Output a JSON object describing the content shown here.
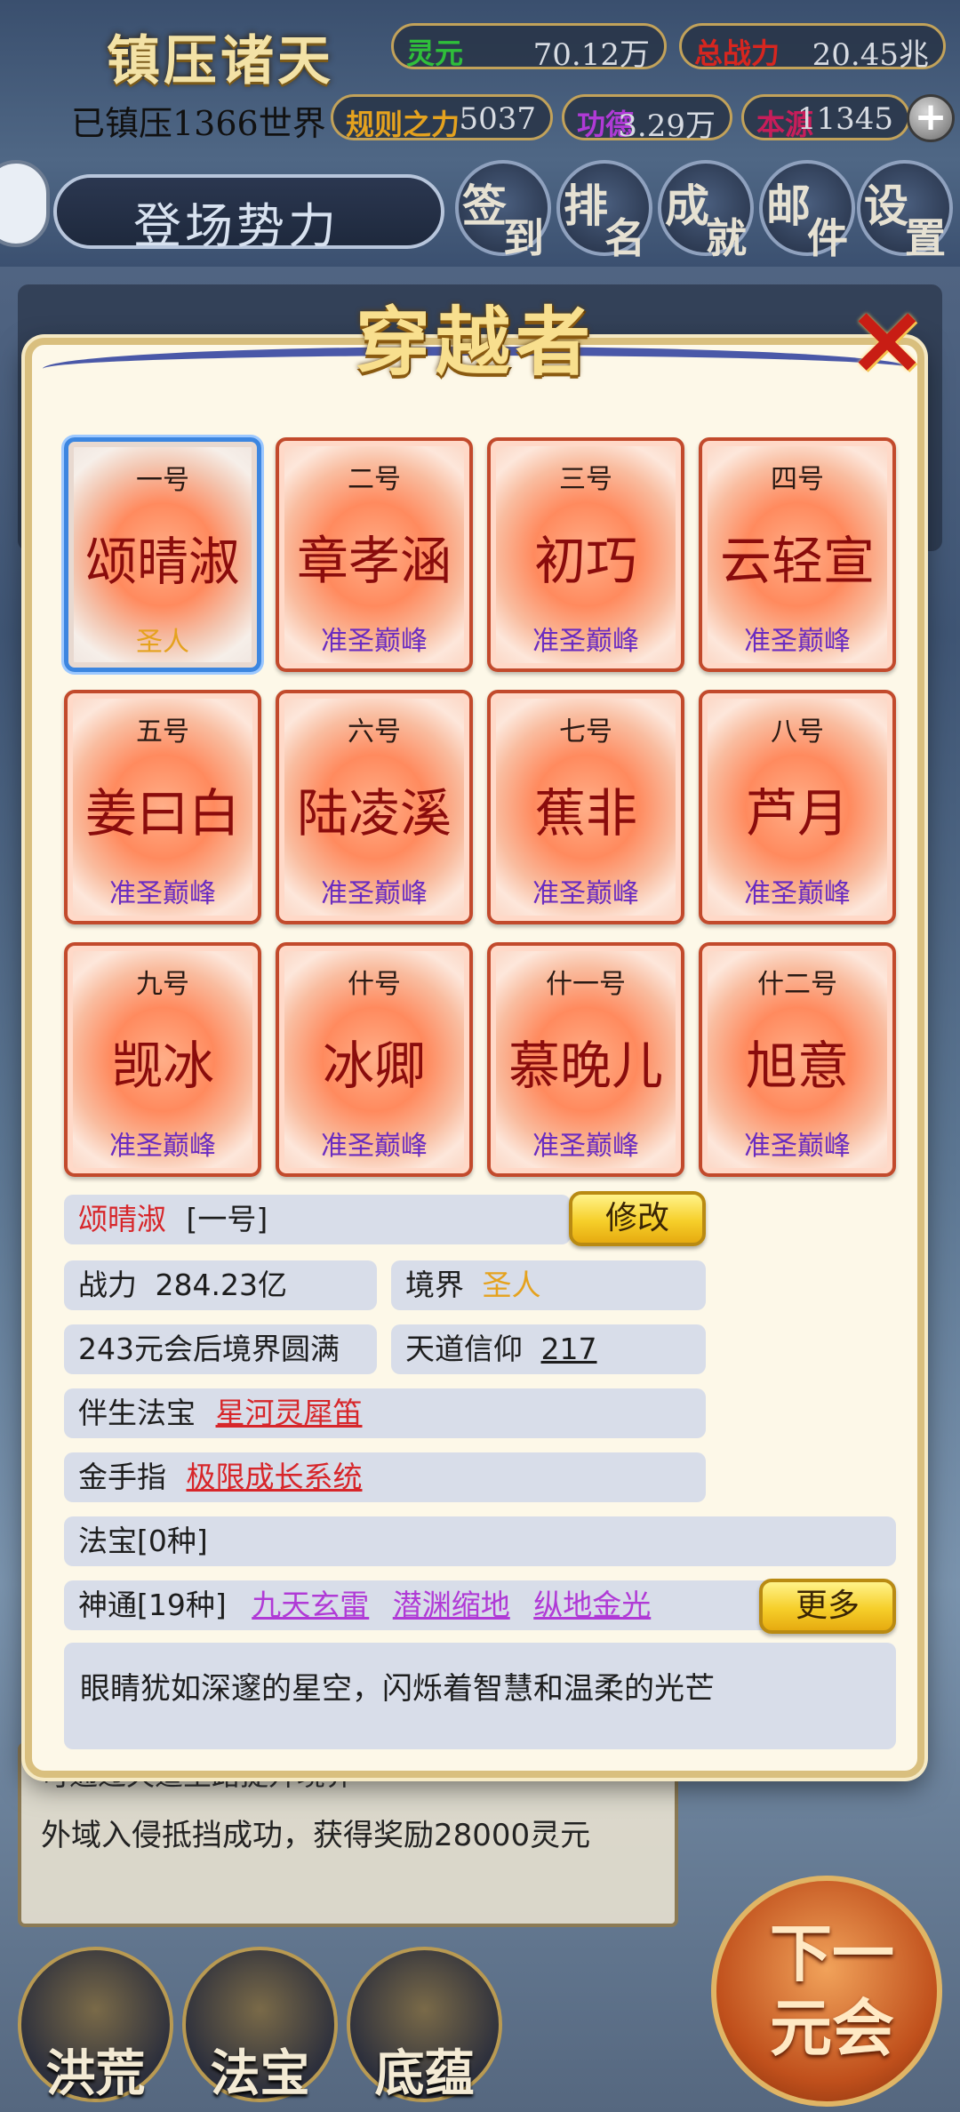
{
  "top": {
    "game_title": "镇压诸天",
    "conquered_text": "已镇压1366世界",
    "stats": [
      {
        "label": "灵元",
        "value": "70.12万",
        "color": "#2fbf3a"
      },
      {
        "label": "总战力",
        "value": "20.45兆",
        "color": "#d7261f"
      },
      {
        "label": "规则之力",
        "value": "5037",
        "color": "#e5a21e"
      },
      {
        "label": "功德",
        "value": "3.29万",
        "color": "#b03ad6"
      },
      {
        "label": "本源",
        "value": "11345",
        "color": "#c81d5a"
      }
    ],
    "faction_label": "登场势力",
    "menu": [
      {
        "c1": "签",
        "c2": "到"
      },
      {
        "c1": "排",
        "c2": "名"
      },
      {
        "c1": "成",
        "c2": "就"
      },
      {
        "c1": "邮",
        "c2": "件"
      },
      {
        "c1": "设",
        "c2": "置"
      }
    ]
  },
  "modal": {
    "title": "穿越者",
    "close_icon": "×",
    "cards": [
      {
        "num": "一号",
        "name": "颂晴淑",
        "realm": "圣人",
        "selected": true
      },
      {
        "num": "二号",
        "name": "章孝涵",
        "realm": "准圣巅峰"
      },
      {
        "num": "三号",
        "name": "初巧",
        "realm": "准圣巅峰"
      },
      {
        "num": "四号",
        "name": "云轻宣",
        "realm": "准圣巅峰"
      },
      {
        "num": "五号",
        "name": "姜曰白",
        "realm": "准圣巅峰"
      },
      {
        "num": "六号",
        "name": "陆凌溪",
        "realm": "准圣巅峰"
      },
      {
        "num": "七号",
        "name": "蕉非",
        "realm": "准圣巅峰"
      },
      {
        "num": "八号",
        "name": "芦月",
        "realm": "准圣巅峰"
      },
      {
        "num": "九号",
        "name": "觊冰",
        "realm": "准圣巅峰"
      },
      {
        "num": "什号",
        "name": "冰卿",
        "realm": "准圣巅峰"
      },
      {
        "num": "什一号",
        "name": "慕晚儿",
        "realm": "准圣巅峰"
      },
      {
        "num": "什二号",
        "name": "旭意",
        "realm": "准圣巅峰"
      }
    ],
    "detail": {
      "name": "颂晴淑",
      "index": "[一号]",
      "edit_label": "修改",
      "power_label": "战力",
      "power_value": "284.23亿",
      "realm_label": "境界",
      "realm_value": "圣人",
      "perfection_text": "243元会后境界圆满",
      "faith_label": "天道信仰",
      "faith_value": "217",
      "companion_label": "伴生法宝",
      "companion_value": "星河灵犀笛",
      "cheat_label": "金手指",
      "cheat_value": "极限成长系统",
      "treasure_text": "法宝[0种]",
      "skills_label": "神通[19种]",
      "skills": [
        "九天玄雷",
        "潜渊缩地",
        "纵地金光"
      ],
      "more_label": "更多",
      "description": "眼睛犹如深邃的星空，闪烁着智慧和温柔的光芒"
    }
  },
  "background": {
    "log_prev": "可通过天道圣路提升境界",
    "log_text": "外域入侵抵挡成功，获得奖励28000灵元",
    "bottom_buttons": [
      "洪荒",
      "法宝",
      "底蕴"
    ],
    "next_label": "下一元会"
  }
}
